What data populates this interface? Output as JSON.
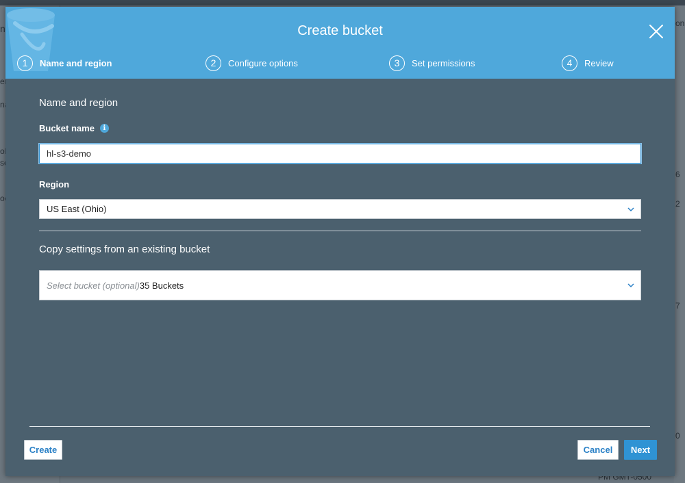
{
  "background": {
    "fragments": [
      "n",
      "er",
      "na",
      "oli",
      "se",
      "oc",
      "on",
      "6",
      "2",
      "7",
      "0",
      "PM GMT-0500"
    ]
  },
  "modal": {
    "title": "Create bucket",
    "steps": [
      {
        "number": "1",
        "label": "Name and region",
        "active": true
      },
      {
        "number": "2",
        "label": "Configure options",
        "active": false
      },
      {
        "number": "3",
        "label": "Set permissions",
        "active": false
      },
      {
        "number": "4",
        "label": "Review",
        "active": false
      }
    ],
    "section_title": "Name and region",
    "bucket_name": {
      "label": "Bucket name",
      "value": "hl-s3-demo"
    },
    "region": {
      "label": "Region",
      "selected": "US East (Ohio)"
    },
    "copy_settings": {
      "title": "Copy settings from an existing bucket",
      "placeholder": "Select bucket (optional)",
      "count_text": "35 Buckets"
    },
    "buttons": {
      "create": "Create",
      "cancel": "Cancel",
      "next": "Next"
    }
  },
  "colors": {
    "header": "#4fa8db",
    "body": "#4b606e",
    "primary": "#2f93d4",
    "link": "#2a80c6"
  }
}
